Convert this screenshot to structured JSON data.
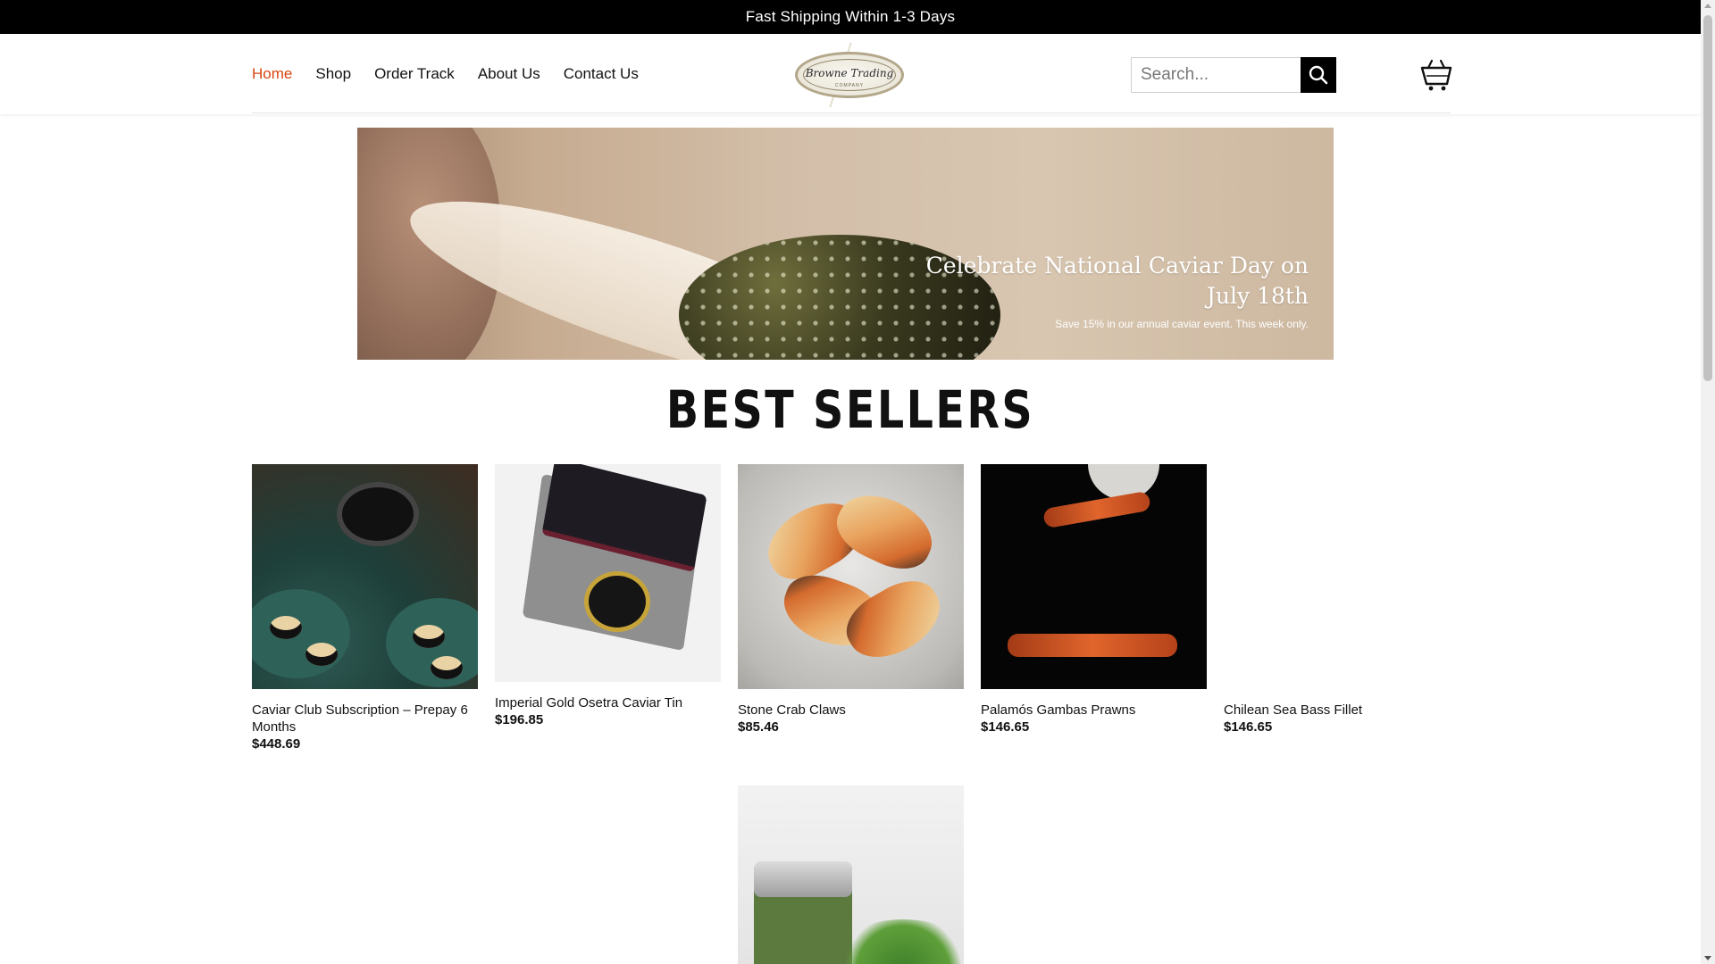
{
  "announcement": "Fast Shipping Within 1-3 Days",
  "nav": {
    "items": [
      {
        "label": "Home",
        "active": true
      },
      {
        "label": "Shop",
        "active": false
      },
      {
        "label": "Order Track",
        "active": false
      },
      {
        "label": "About Us",
        "active": false
      },
      {
        "label": "Contact Us",
        "active": false
      }
    ]
  },
  "logo": {
    "brand": "Browne Trading",
    "sub": "COMPANY"
  },
  "search": {
    "placeholder": "Search..."
  },
  "icons": {
    "search": "search-icon",
    "cart": "cart-icon"
  },
  "banner": {
    "headline_line1": "Celebrate National Caviar Day on",
    "headline_line2": "July 18th",
    "subline": "Save 15% in our annual caviar event. This week only."
  },
  "section_title": "BEST SELLERS",
  "products": [
    {
      "name": "Caviar Club Subscription – Prepay 6 Months",
      "price": "$448.69"
    },
    {
      "name": "Imperial Gold Osetra Caviar Tin",
      "price": "$196.85"
    },
    {
      "name": "Stone Crab Claws",
      "price": "$85.46"
    },
    {
      "name": "Palamós Gambas Prawns",
      "price": "$146.65"
    },
    {
      "name": "Chilean Sea Bass Fillet",
      "price": "$146.65"
    },
    {
      "name": "",
      "price": ""
    }
  ],
  "colors": {
    "accent": "#d5450f",
    "topbar": "#000000"
  }
}
